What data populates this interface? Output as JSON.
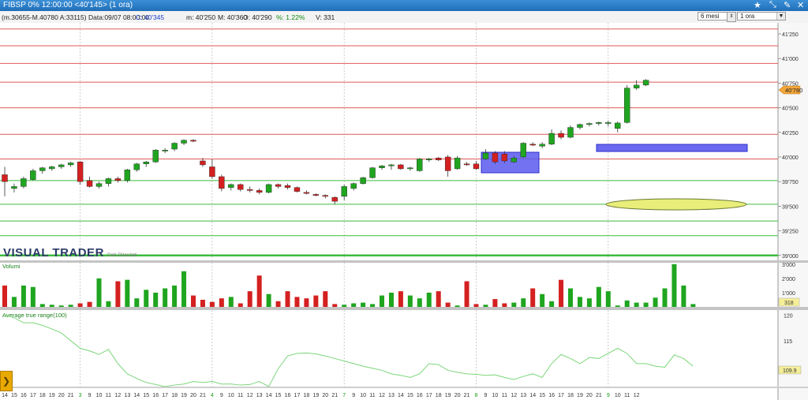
{
  "window": {
    "title": "FIBSP 0%  12:00:00  <40'145>  (1 ora)",
    "icons": [
      "star-icon",
      "maximize-arrow-icon",
      "settings-icon",
      "close-icon"
    ]
  },
  "infobar": {
    "range": "(m.30655-M.40780 A:33115)",
    "date": "Data:09/07 08:00:00",
    "close": "C: 40'345",
    "low": "m: 40'250",
    "high": "M: 40'360",
    "open": "O: 40'290",
    "pct": "%: 1.22%",
    "volume": "V: 331",
    "period_select": "6 mesi",
    "timeframe_select": "1 ora"
  },
  "price_panel": {
    "axis_labels": [
      "41'250",
      "41'000",
      "40'750",
      "40'500",
      "40'250",
      "40'000",
      "39'750",
      "39'500",
      "39'250",
      "39'000"
    ],
    "axis_values": [
      41250,
      41000,
      40750,
      40500,
      40250,
      40000,
      39750,
      39500,
      39250,
      39000
    ],
    "last_price": "40'780",
    "watermark": "VISUAL TRADER",
    "source": "Dati Ritardati"
  },
  "volume_panel": {
    "title": "Volumi",
    "axis_labels": [
      "3'000",
      "2'000",
      "1'000"
    ],
    "last_value": "318"
  },
  "atr_panel": {
    "title": "Average true range(100)",
    "axis_labels": [
      "120",
      "115"
    ],
    "last_value": "109.9"
  },
  "x_axis": {
    "labels": [
      "14",
      "15",
      "16",
      "17",
      "18",
      "19",
      "20",
      "21",
      "3",
      "9",
      "10",
      "11",
      "12",
      "13",
      "14",
      "15",
      "16",
      "17",
      "18",
      "19",
      "20",
      "21",
      "4",
      "9",
      "10",
      "11",
      "12",
      "13",
      "14",
      "15",
      "16",
      "17",
      "18",
      "19",
      "20",
      "21",
      "7",
      "9",
      "10",
      "11",
      "12",
      "13",
      "14",
      "15",
      "16",
      "17",
      "18",
      "19",
      "20",
      "21",
      "8",
      "9",
      "10",
      "11",
      "12",
      "13",
      "14",
      "15",
      "16",
      "17",
      "18",
      "19",
      "20",
      "21",
      "9",
      "10",
      "11",
      "12"
    ],
    "day_starts": [
      "3",
      "4",
      "7",
      "8",
      "9"
    ]
  },
  "chart_data": {
    "type": "candlestick",
    "price_axis_range": [
      38990,
      41330
    ],
    "volume_axis_range": [
      0,
      3100
    ],
    "atr_axis_range": [
      106,
      121
    ],
    "horizontal_levels": {
      "red": [
        41300,
        41130,
        40950,
        40760,
        40500,
        40230,
        39980
      ],
      "green": [
        39760,
        39520,
        39350,
        39200,
        39000
      ]
    },
    "candles": [
      {
        "o": 39820,
        "h": 39900,
        "l": 39600,
        "c": 39750
      },
      {
        "o": 39680,
        "h": 39730,
        "l": 39640,
        "c": 39700
      },
      {
        "o": 39700,
        "h": 39800,
        "l": 39680,
        "c": 39780
      },
      {
        "o": 39770,
        "h": 39880,
        "l": 39760,
        "c": 39860
      },
      {
        "o": 39860,
        "h": 39900,
        "l": 39830,
        "c": 39890
      },
      {
        "o": 39880,
        "h": 39910,
        "l": 39860,
        "c": 39900
      },
      {
        "o": 39900,
        "h": 39930,
        "l": 39880,
        "c": 39920
      },
      {
        "o": 39920,
        "h": 39950,
        "l": 39900,
        "c": 39940
      },
      {
        "o": 39950,
        "h": 39960,
        "l": 39720,
        "c": 39750
      },
      {
        "o": 39760,
        "h": 39800,
        "l": 39690,
        "c": 39700
      },
      {
        "o": 39700,
        "h": 39750,
        "l": 39680,
        "c": 39730
      },
      {
        "o": 39730,
        "h": 39790,
        "l": 39700,
        "c": 39780
      },
      {
        "o": 39780,
        "h": 39800,
        "l": 39740,
        "c": 39760
      },
      {
        "o": 39760,
        "h": 39880,
        "l": 39740,
        "c": 39870
      },
      {
        "o": 39870,
        "h": 39940,
        "l": 39850,
        "c": 39930
      },
      {
        "o": 39930,
        "h": 39960,
        "l": 39900,
        "c": 39950
      },
      {
        "o": 39950,
        "h": 40080,
        "l": 39940,
        "c": 40070
      },
      {
        "o": 40060,
        "h": 40090,
        "l": 40040,
        "c": 40070
      },
      {
        "o": 40080,
        "h": 40150,
        "l": 40060,
        "c": 40140
      },
      {
        "o": 40140,
        "h": 40180,
        "l": 40120,
        "c": 40170
      },
      {
        "o": 40170,
        "h": 40180,
        "l": 40150,
        "c": 40160
      },
      {
        "o": 39960,
        "h": 39990,
        "l": 39900,
        "c": 39920
      },
      {
        "o": 39900,
        "h": 39980,
        "l": 39780,
        "c": 39800
      },
      {
        "o": 39800,
        "h": 39820,
        "l": 39650,
        "c": 39680
      },
      {
        "o": 39690,
        "h": 39730,
        "l": 39660,
        "c": 39720
      },
      {
        "o": 39720,
        "h": 39730,
        "l": 39650,
        "c": 39670
      },
      {
        "o": 39670,
        "h": 39700,
        "l": 39640,
        "c": 39660
      },
      {
        "o": 39660,
        "h": 39680,
        "l": 39620,
        "c": 39640
      },
      {
        "o": 39640,
        "h": 39730,
        "l": 39630,
        "c": 39720
      },
      {
        "o": 39720,
        "h": 39730,
        "l": 39680,
        "c": 39700
      },
      {
        "o": 39710,
        "h": 39730,
        "l": 39670,
        "c": 39690
      },
      {
        "o": 39690,
        "h": 39700,
        "l": 39640,
        "c": 39650
      },
      {
        "o": 39640,
        "h": 39660,
        "l": 39620,
        "c": 39630
      },
      {
        "o": 39620,
        "h": 39630,
        "l": 39600,
        "c": 39610
      },
      {
        "o": 39610,
        "h": 39620,
        "l": 39580,
        "c": 39600
      },
      {
        "o": 39590,
        "h": 39600,
        "l": 39520,
        "c": 39550
      },
      {
        "o": 39600,
        "h": 39720,
        "l": 39560,
        "c": 39700
      },
      {
        "o": 39680,
        "h": 39740,
        "l": 39660,
        "c": 39730
      },
      {
        "o": 39730,
        "h": 39800,
        "l": 39720,
        "c": 39790
      },
      {
        "o": 39790,
        "h": 39900,
        "l": 39780,
        "c": 39890
      },
      {
        "o": 39890,
        "h": 39920,
        "l": 39870,
        "c": 39910
      },
      {
        "o": 39910,
        "h": 39930,
        "l": 39870,
        "c": 39920
      },
      {
        "o": 39920,
        "h": 39930,
        "l": 39870,
        "c": 39880
      },
      {
        "o": 39880,
        "h": 39900,
        "l": 39860,
        "c": 39890
      },
      {
        "o": 39860,
        "h": 39990,
        "l": 39850,
        "c": 39980
      },
      {
        "o": 39970,
        "h": 39990,
        "l": 39950,
        "c": 39980
      },
      {
        "o": 39990,
        "h": 40000,
        "l": 39960,
        "c": 39970
      },
      {
        "o": 40000,
        "h": 40020,
        "l": 39800,
        "c": 39860
      },
      {
        "o": 39880,
        "h": 40010,
        "l": 39870,
        "c": 39990
      },
      {
        "o": 39930,
        "h": 39950,
        "l": 39910,
        "c": 39920
      },
      {
        "o": 39930,
        "h": 39960,
        "l": 39870,
        "c": 39880
      },
      {
        "o": 39980,
        "h": 40080,
        "l": 39970,
        "c": 40040
      },
      {
        "o": 40040,
        "h": 40060,
        "l": 39930,
        "c": 39950
      },
      {
        "o": 40030,
        "h": 40060,
        "l": 39940,
        "c": 39960
      },
      {
        "o": 39950,
        "h": 40010,
        "l": 39940,
        "c": 39990
      },
      {
        "o": 40000,
        "h": 40150,
        "l": 39990,
        "c": 40140
      },
      {
        "o": 40130,
        "h": 40150,
        "l": 40110,
        "c": 40120
      },
      {
        "o": 40110,
        "h": 40150,
        "l": 40090,
        "c": 40130
      },
      {
        "o": 40130,
        "h": 40280,
        "l": 40120,
        "c": 40240
      },
      {
        "o": 40240,
        "h": 40270,
        "l": 40180,
        "c": 40200
      },
      {
        "o": 40200,
        "h": 40320,
        "l": 40190,
        "c": 40300
      },
      {
        "o": 40300,
        "h": 40340,
        "l": 40280,
        "c": 40330
      },
      {
        "o": 40330,
        "h": 40350,
        "l": 40310,
        "c": 40340
      },
      {
        "o": 40340,
        "h": 40360,
        "l": 40320,
        "c": 40350
      },
      {
        "o": 40350,
        "h": 40370,
        "l": 40310,
        "c": 40350
      },
      {
        "o": 40290,
        "h": 40360,
        "l": 40250,
        "c": 40345
      },
      {
        "o": 40350,
        "h": 40730,
        "l": 40340,
        "c": 40700
      },
      {
        "o": 40700,
        "h": 40780,
        "l": 40680,
        "c": 40730
      },
      {
        "o": 40730,
        "h": 40790,
        "l": 40720,
        "c": 40780
      }
    ],
    "volumes": [
      1500,
      700,
      1500,
      1400,
      200,
      150,
      100,
      150,
      250,
      350,
      2000,
      400,
      1800,
      1900,
      600,
      1200,
      1000,
      1300,
      1500,
      2500,
      800,
      500,
      350,
      600,
      700,
      250,
      1100,
      2200,
      900,
      400,
      1100,
      700,
      600,
      800,
      1100,
      200,
      150,
      250,
      300,
      200,
      800,
      1000,
      1100,
      800,
      600,
      1000,
      1100,
      300,
      100,
      1800,
      200,
      150,
      550,
      250,
      300,
      600,
      1300,
      900,
      400,
      1900,
      1300,
      700,
      600,
      1400,
      1100,
      100,
      450,
      300,
      300,
      650,
      1300,
      3000,
      1500,
      200
    ],
    "atr": [
      120,
      119.5,
      118.5,
      118.5,
      118,
      117.3,
      116.5,
      115,
      113.5,
      113,
      112.3,
      113.3,
      110.5,
      108.5,
      107.6,
      106.8,
      106.4,
      106,
      106.3,
      106.5,
      107,
      106.8,
      107,
      106.5,
      106.5,
      106.3,
      106.4,
      107,
      106,
      109.5,
      112,
      112.5,
      112.6,
      112.4,
      112,
      111.5,
      111,
      110.5,
      110,
      109.6,
      109.2,
      108.5,
      108.2,
      107.8,
      108.5,
      110.5,
      110.3,
      109.2,
      108.8,
      108.5,
      108.4,
      108.2,
      108.3,
      107.8,
      107.4,
      108,
      108.5,
      107.8,
      110.5,
      112.3,
      111.5,
      110.5,
      111.7,
      111.5,
      112.5,
      113.5,
      112.5,
      110.5,
      110.5,
      110,
      109.8,
      112.2,
      111.5,
      110
    ]
  }
}
